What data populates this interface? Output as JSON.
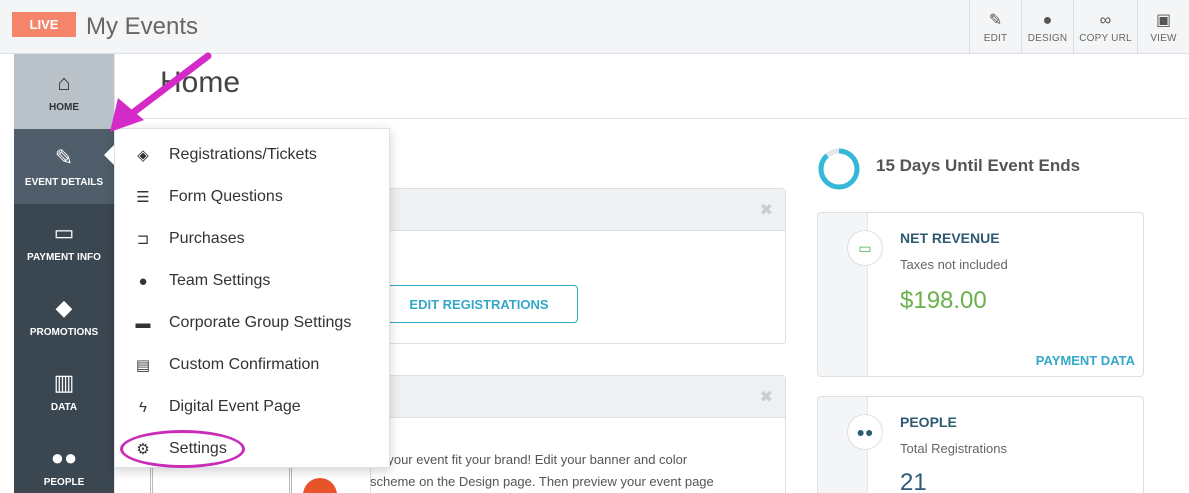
{
  "header": {
    "live_badge": "LIVE",
    "title": "My Events",
    "tools": [
      {
        "label": "EDIT",
        "icon": "edit-icon"
      },
      {
        "label": "DESIGN",
        "icon": "droplet-icon"
      },
      {
        "label": "COPY URL",
        "icon": "link-icon"
      },
      {
        "label": "VIEW",
        "icon": "image-icon"
      }
    ]
  },
  "sidebar": {
    "items": [
      {
        "label": "HOME",
        "icon": "home-icon"
      },
      {
        "label": "EVENT DETAILS",
        "icon": "edit-icon"
      },
      {
        "label": "PAYMENT INFO",
        "icon": "money-icon"
      },
      {
        "label": "PROMOTIONS",
        "icon": "tag-icon"
      },
      {
        "label": "DATA",
        "icon": "bar-chart-icon"
      },
      {
        "label": "PEOPLE",
        "icon": "people-icon"
      }
    ]
  },
  "main": {
    "title": "Home",
    "edit_registrations": "EDIT REGISTRATIONS",
    "design_text_1": "ke your event fit your brand! Edit your banner and color",
    "design_text_2": "scheme on the Design page. Then preview your event page"
  },
  "stats": {
    "days_label": "15 Days Until Event Ends",
    "revenue": {
      "label": "NET REVENUE",
      "sub": "Taxes not included",
      "value": "$198.00",
      "link": "PAYMENT DATA",
      "value_color": "#6ab04c"
    },
    "people": {
      "label": "PEOPLE",
      "sub": "Total Registrations",
      "value": "21",
      "value_color": "#2f5a73"
    }
  },
  "menu": {
    "items": [
      {
        "label": "Registrations/Tickets",
        "icon": "ticket-icon"
      },
      {
        "label": "Form Questions",
        "icon": "list-icon"
      },
      {
        "label": "Purchases",
        "icon": "cart-icon"
      },
      {
        "label": "Team Settings",
        "icon": "chat-icon"
      },
      {
        "label": "Corporate Group Settings",
        "icon": "briefcase-icon"
      },
      {
        "label": "Custom Confirmation",
        "icon": "document-icon"
      },
      {
        "label": "Digital Event Page",
        "icon": "bolt-icon"
      },
      {
        "label": "Settings",
        "icon": "gear-icon"
      }
    ]
  },
  "colors": {
    "accent": "#34a8c8",
    "live": "#f4846a",
    "sidebar": "#3a4650",
    "annotation": "#d42ac8"
  }
}
